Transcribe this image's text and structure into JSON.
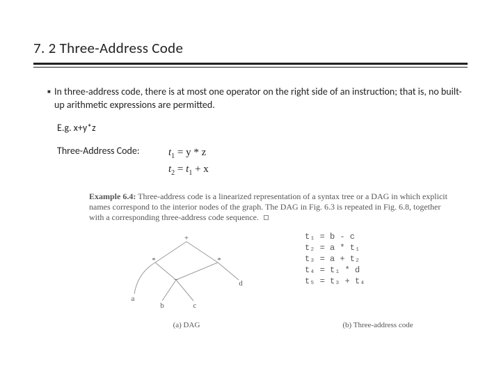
{
  "title": "7. 2 Three-Address Code",
  "bullet": "In three-address code, there is at most one operator on the right side of an instruction; that is, no built-up arithmetic expressions are permitted.",
  "eg_label": "E.g. x+y*z",
  "tac_label": "Three-Address Code:",
  "formula": {
    "line1": {
      "lhs_t": "t",
      "lhs_sub": "1",
      "rhs": "= y * z"
    },
    "line2": {
      "lhs_t": "t",
      "lhs_sub": "2",
      "eq": "= ",
      "a_t": "t",
      "a_sub": "1",
      "plus_x": " + x"
    }
  },
  "example": {
    "lead": "Example 6.4:",
    "text": " Three-address code is a linearized representation of a syntax tree or a DAG in which explicit names correspond to the interior nodes of the graph. The DAG in Fig. 6.3 is repeated in Fig. 6.8, together with a corresponding three-address code sequence."
  },
  "dag": {
    "nodes": {
      "plus": "+",
      "star1": "*",
      "star2": "*",
      "minus": "−",
      "a": "a",
      "b": "b",
      "c": "c",
      "d": "d"
    }
  },
  "tac_code": [
    "t₁ = b - c",
    "t₂ = a * t₁",
    "t₃ = a + t₂",
    "t₄ = t₁ * d",
    "t₅ = t₃ + t₄"
  ],
  "captions": {
    "a": "(a) DAG",
    "b": "(b) Three-address code"
  }
}
